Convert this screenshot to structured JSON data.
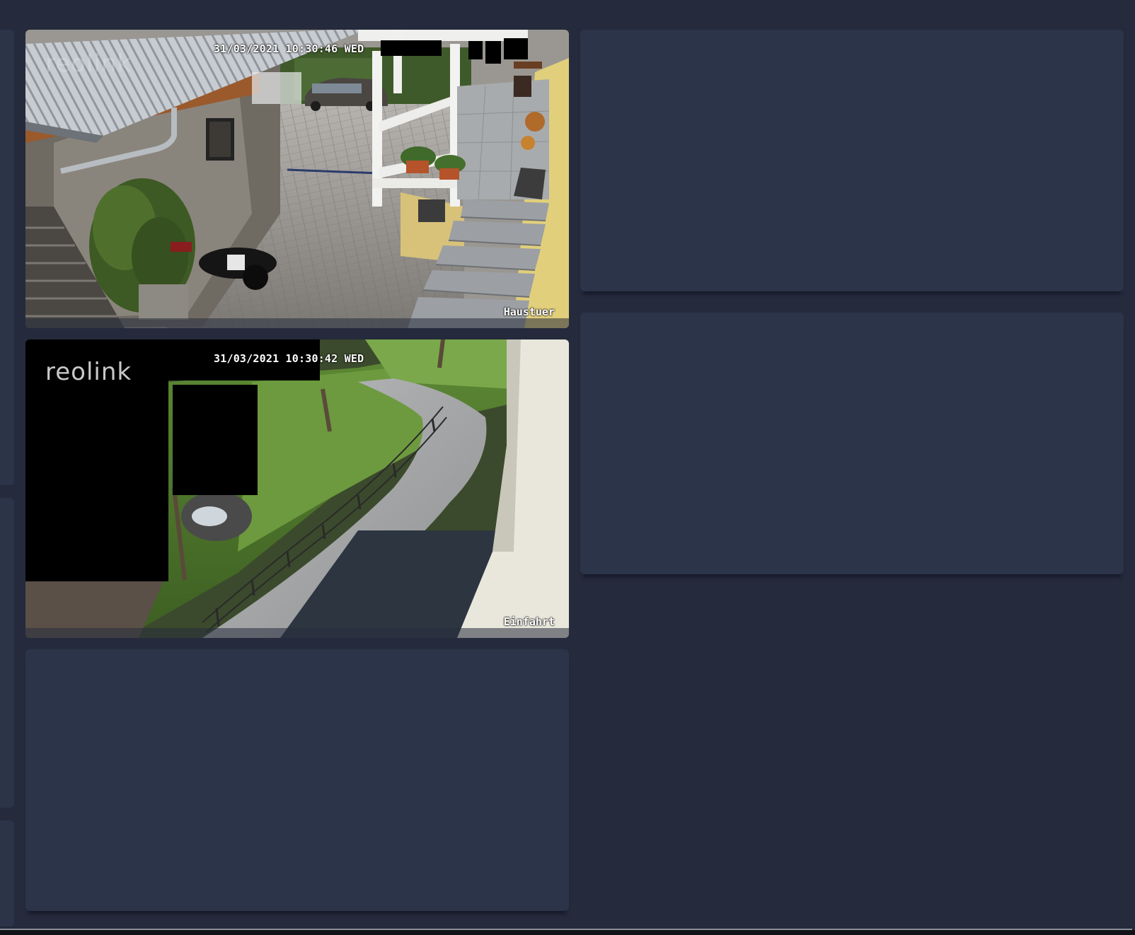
{
  "colors": {
    "background": "#252a3c",
    "card": "#2b3448",
    "overlay_text": "#ffffff"
  },
  "cameras": [
    {
      "name": "Haustuer",
      "timestamp": "31/03/2021 10:30:46 WED",
      "brand": "reolink"
    },
    {
      "name": "Einfahrt",
      "timestamp": "31/03/2021 10:30:42 WED",
      "brand": "reolink"
    }
  ]
}
